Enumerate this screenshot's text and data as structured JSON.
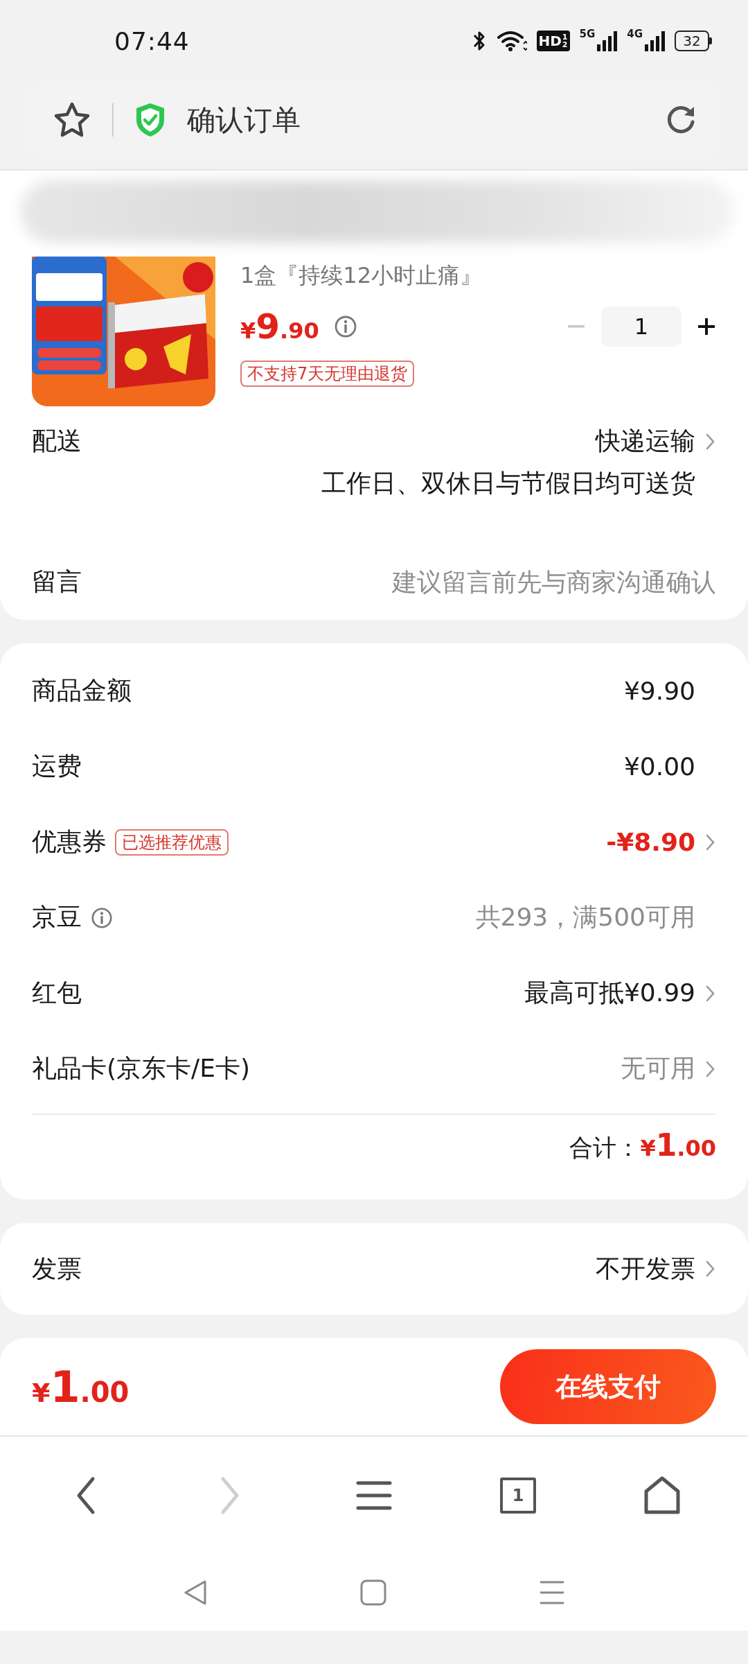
{
  "status_bar": {
    "time": "07:44",
    "hd": "HD",
    "hd_fraction": [
      "1",
      "2"
    ],
    "signals": [
      {
        "label": "5G"
      },
      {
        "label": "4G"
      }
    ],
    "battery": "32"
  },
  "address_bar": {
    "title": "确认订单"
  },
  "product": {
    "title": "1盒『持续12小时止痛』",
    "price_symbol": "¥",
    "price_int": "9",
    "price_dec": ".90",
    "quantity": "1",
    "tag": "不支持7天无理由退货"
  },
  "delivery": {
    "label": "配送",
    "value": "快递运输",
    "note": "工作日、双休日与节假日均可送货"
  },
  "message": {
    "label": "留言",
    "placeholder": "建议留言前先与商家沟通确认"
  },
  "fees": [
    {
      "label": "商品金额",
      "value": "¥9.90",
      "kind": "normal",
      "chevron": false,
      "info": false
    },
    {
      "label": "运费",
      "value": "¥0.00",
      "kind": "normal",
      "chevron": false,
      "info": false
    },
    {
      "label": "优惠券",
      "badge": "已选推荐优惠",
      "value": "-¥8.90",
      "kind": "discount",
      "chevron": true,
      "info": false
    },
    {
      "label": "京豆",
      "value": "共293，满500可用",
      "kind": "muted",
      "chevron": false,
      "info": true
    },
    {
      "label": "红包",
      "value": "最高可抵¥0.99",
      "kind": "normal",
      "chevron": true,
      "info": false
    },
    {
      "label": "礼品卡(京东卡/E卡)",
      "value": "无可用",
      "kind": "muted",
      "chevron": true,
      "info": false
    }
  ],
  "total": {
    "label": "合计：",
    "symbol": "¥",
    "int": "1",
    "dec": ".00"
  },
  "invoice": {
    "label": "发票",
    "value": "不开发票"
  },
  "pay_bar": {
    "symbol": "¥",
    "int": "1",
    "dec": ".00",
    "button": "在线支付"
  },
  "browser_nav": [
    {
      "kind": "back",
      "disabled": false
    },
    {
      "kind": "forward",
      "disabled": true
    },
    {
      "kind": "menu",
      "disabled": false
    },
    {
      "kind": "tabs",
      "count": "1",
      "disabled": false
    },
    {
      "kind": "home",
      "disabled": false
    }
  ]
}
